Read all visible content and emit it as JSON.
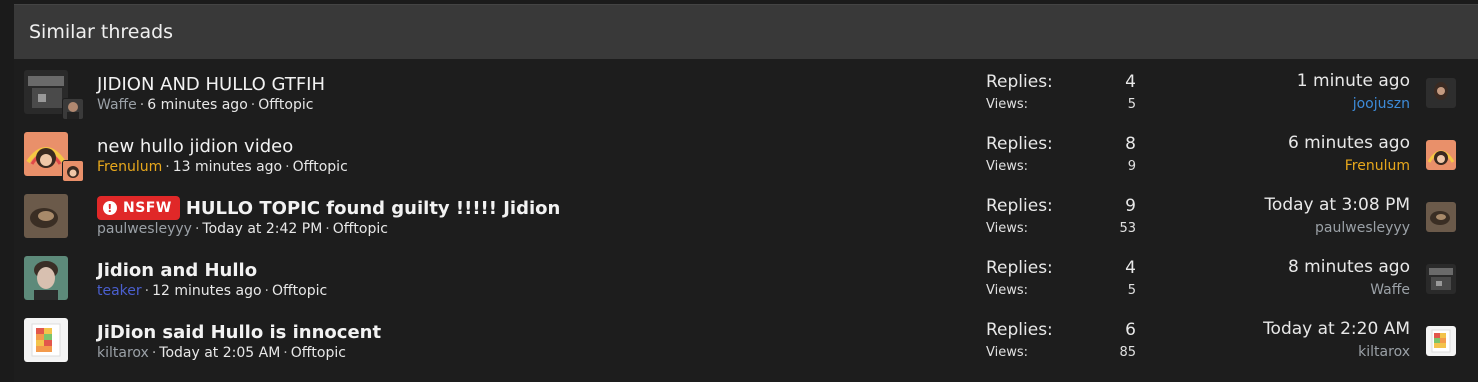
{
  "header": {
    "title": "Similar threads"
  },
  "threads": [
    {
      "title": "JIDION AND HULLO GTFIH",
      "author": "Waffe",
      "author_color": "#9aa0a6",
      "time": "6 minutes ago",
      "forum": "Offtopic",
      "replies_label": "Replies:",
      "replies": "4",
      "views_label": "Views:",
      "views": "5",
      "last_time": "1 minute ago",
      "last_user": "joojuszn",
      "last_user_color": "#3d8bd9"
    },
    {
      "title": "new hullo jidion video",
      "author": "Frenulum",
      "author_color": "#e8a81c",
      "time": "13 minutes ago",
      "forum": "Offtopic",
      "replies_label": "Replies:",
      "replies": "8",
      "views_label": "Views:",
      "views": "9",
      "last_time": "6 minutes ago",
      "last_user": "Frenulum",
      "last_user_color": "#e8a81c"
    },
    {
      "badge": "NSFW",
      "title": "HULLO TOPIC found guilty !!!!! Jidion",
      "author": "paulwesleyyy",
      "author_color": "#9aa0a6",
      "time": "Today at 2:42 PM",
      "forum": "Offtopic",
      "replies_label": "Replies:",
      "replies": "9",
      "views_label": "Views:",
      "views": "53",
      "last_time": "Today at 3:08 PM",
      "last_user": "paulwesleyyy",
      "last_user_color": "#9aa0a6"
    },
    {
      "title": "Jidion and Hullo",
      "author": "teaker",
      "author_color": "#4a5fcf",
      "time": "12 minutes ago",
      "forum": "Offtopic",
      "replies_label": "Replies:",
      "replies": "4",
      "views_label": "Views:",
      "views": "5",
      "last_time": "8 minutes ago",
      "last_user": "Waffe",
      "last_user_color": "#9aa0a6"
    },
    {
      "title": "JiDion said Hullo is innocent",
      "author": "kiltarox",
      "author_color": "#9aa0a6",
      "time": "Today at 2:05 AM",
      "forum": "Offtopic",
      "replies_label": "Replies:",
      "replies": "6",
      "views_label": "Views:",
      "views": "85",
      "last_time": "Today at 2:20 AM",
      "last_user": "kiltarox",
      "last_user_color": "#9aa0a6"
    }
  ],
  "colors": {
    "background": "#1d1d1d",
    "header_bg": "#393939",
    "nsfw_badge": "#e02828",
    "meta_gray": "#9aa0a6"
  }
}
